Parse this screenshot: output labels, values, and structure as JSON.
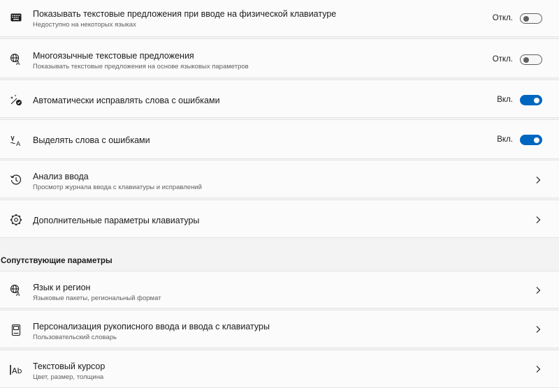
{
  "settings": [
    {
      "title": "Показывать текстовые предложения при вводе на физической клавиатуре",
      "subtitle": "Недоступно на некоторых языках",
      "state": "Откл.",
      "toggle": "off",
      "icon": "keyboard-icon"
    },
    {
      "title": "Многоязычные текстовые предложения",
      "subtitle": "Показывать текстовые предложения на основе языковых параметров",
      "state": "Откл.",
      "toggle": "off",
      "icon": "language-icon"
    },
    {
      "title": "Автоматически исправлять слова с ошибками",
      "state": "Вкл.",
      "toggle": "on",
      "icon": "autocorrect-icon"
    },
    {
      "title": "Выделять слова с ошибками",
      "state": "Вкл.",
      "toggle": "on",
      "icon": "spellcheck-icon"
    },
    {
      "title": "Анализ ввода",
      "subtitle": "Просмотр журнала ввода с клавиатуры и исправлений",
      "icon": "history-icon"
    },
    {
      "title": "Дополнительные параметры клавиатуры",
      "icon": "gear-icon"
    }
  ],
  "related": {
    "heading": "Сопутствующие параметры",
    "items": [
      {
        "title": "Язык и регион",
        "subtitle": "Языковые пакеты, региональный формат",
        "icon": "language-icon"
      },
      {
        "title": "Персонализация рукописного ввода и ввода с клавиатуры",
        "subtitle": "Пользовательский словарь",
        "icon": "notebook-icon"
      },
      {
        "title": "Текстовый курсор",
        "subtitle": "Цвет, размер, толщина",
        "icon": "text-cursor-icon"
      }
    ]
  },
  "colors": {
    "accent": "#0067c0",
    "background": "#f3f3f3",
    "card": "#fbfbfb"
  }
}
